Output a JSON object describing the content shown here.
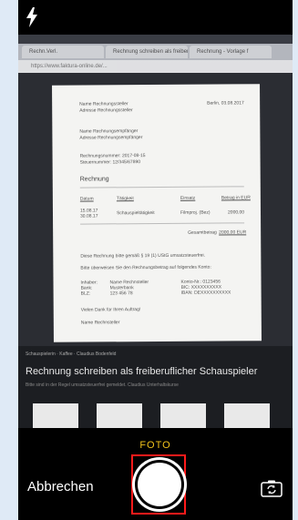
{
  "camera": {
    "mode_label": "FOTO",
    "cancel_label": "Abbrechen",
    "icons": {
      "flash": "flash-icon",
      "flip": "camera-flip-icon",
      "shutter": "shutter-button"
    },
    "accent_color": "#f1c21b",
    "highlight_color": "#ff1a1a"
  },
  "viewfinder_content": {
    "tabs": [
      "Rechn.Verl.",
      "Rechnung schreiben als freiberuflicher Schauspieler",
      "Rechnung - Vorlage f"
    ],
    "address": "https://www.faktura-online.de/...",
    "document": {
      "sender_name": "Name Rechnungssteller",
      "sender_street": "Adresse Rechnungssteller",
      "date": "Berlin, 03.08.2017",
      "recipient_name": "Name Rechnungsempfänger",
      "recipient_street": "Adresse Rechnungsempfänger",
      "invoice_no": "Rechnungsnummer: 2017-08-15",
      "tax_no": "Steuernummer: 12/345/67890",
      "heading": "Rechnung",
      "table_headers": [
        "Datum",
        "Tätigkeit",
        "Einsatz",
        "Betrag in EUR"
      ],
      "row_dates": [
        "15.08.17",
        "30.08.17"
      ],
      "row_activity": "Schauspieltätigkeit",
      "row_place": "Filmproj. (Bez)",
      "row_amount": "2000,00",
      "total_label": "Gesamtbetrag",
      "total_value": "2000,00 EUR",
      "payment_note": "Diese Rechnung bitte gemäß § 19 (1) UStG umsatzsteuerfrei.",
      "transfer_note": "Bitte überweisen Sie den Rechnungsbetrag auf folgendes Konto:",
      "bank_labels": [
        "Inhaber:",
        "Bank:",
        "BLZ:"
      ],
      "bank_values": [
        "Name Rechnsteller",
        "Musterbank",
        "123 456 78"
      ],
      "bank_extra": [
        "Konto-Nr.: 0123456",
        "BIC: XXXXXXXXXX",
        "IBAN: DEXXXXXXXXXX"
      ],
      "thanks": "Vielen Dank für Ihren Auftrag!",
      "signature": "Name Rechnsteller"
    },
    "video": {
      "channel": "Schauspielerin · Kaffee · Claudius Bodenfeld",
      "title": "Rechnung schreiben als freiberuflicher Schauspieler",
      "subtitle": "Bitte sind in der Regel umsatzsteuerfrei gemeldet. Claudius Unterhaltskurse"
    }
  }
}
